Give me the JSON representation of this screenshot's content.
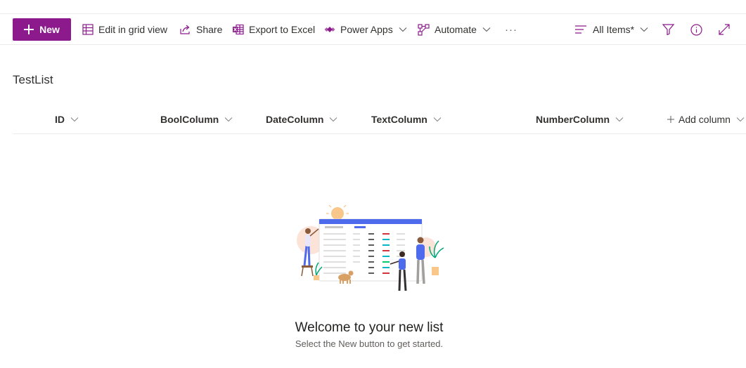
{
  "toolbar": {
    "new_label": "New",
    "edit_grid_label": "Edit in grid view",
    "share_label": "Share",
    "export_label": "Export to Excel",
    "powerapps_label": "Power Apps",
    "automate_label": "Automate",
    "more_label": "···",
    "view_label": "All Items*"
  },
  "list": {
    "title": "TestList",
    "columns": [
      "ID",
      "BoolColumn",
      "DateColumn",
      "TextColumn",
      "NumberColumn"
    ],
    "add_column_label": "Add column"
  },
  "empty_state": {
    "title": "Welcome to your new list",
    "subtitle": "Select the New button to get started."
  },
  "colors": {
    "accent": "#8c1a8c",
    "icon": "#8c1a8c",
    "divider": "#edebe9"
  }
}
